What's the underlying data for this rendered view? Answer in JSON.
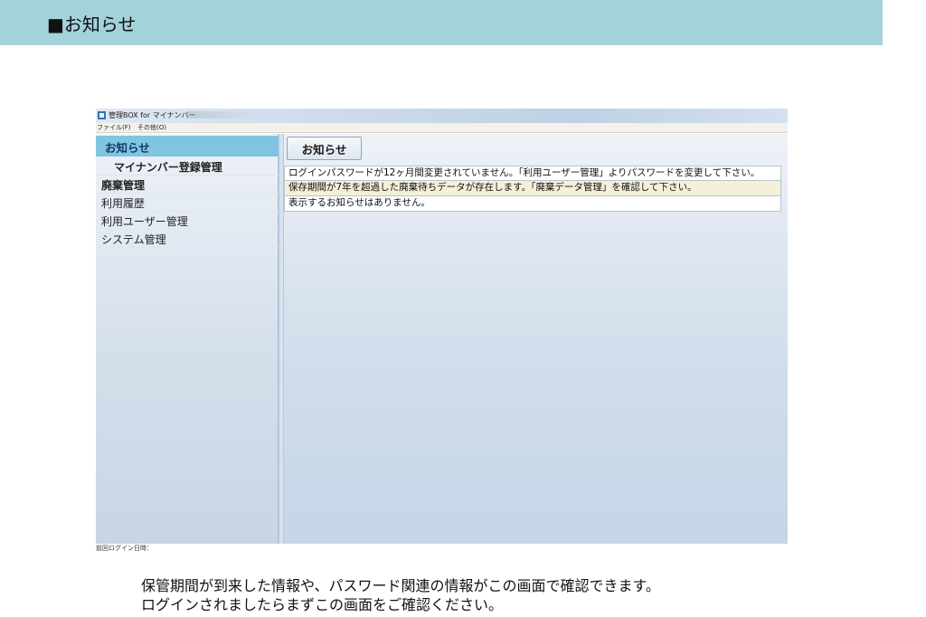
{
  "page": {
    "header_title": "■お知らせ",
    "header_color": "#a3d2da",
    "caption_lines": [
      "保管期間が到来した情報や、パスワード関連の情報がこの画面で確認できます。",
      "ログインされましたらまずこの画面をご確認ください。"
    ]
  },
  "window": {
    "title": "管理BOX for マイナンバー",
    "menu": [
      "ファイル(F)",
      "その他(O)"
    ],
    "status_text": "前回ログイン日時："
  },
  "sidebar": {
    "header": "お知らせ",
    "header_color": "#7fc5e2",
    "items": [
      {
        "label": "マイナンバー登録管理",
        "bold": true
      },
      {
        "label": "廃棄管理",
        "bold": true
      },
      {
        "label": "利用履歴",
        "bold": false
      },
      {
        "label": "利用ユーザー管理",
        "bold": false
      },
      {
        "label": "システム管理",
        "bold": false
      }
    ]
  },
  "main": {
    "button_label": "お知らせ",
    "notices": [
      {
        "text": "ログインパスワードが12ヶ月間変更されていません。「利用ユーザー管理」よりパスワードを変更して下さい。",
        "bg": "#ffffff"
      },
      {
        "text": "保存期間が7年を超過した廃棄待ちデータが存在します。「廃棄データ管理」を確認して下さい。",
        "bg": "#f5f0d8"
      },
      {
        "text": "表示するお知らせはありません。",
        "bg": "#ffffff"
      }
    ]
  }
}
